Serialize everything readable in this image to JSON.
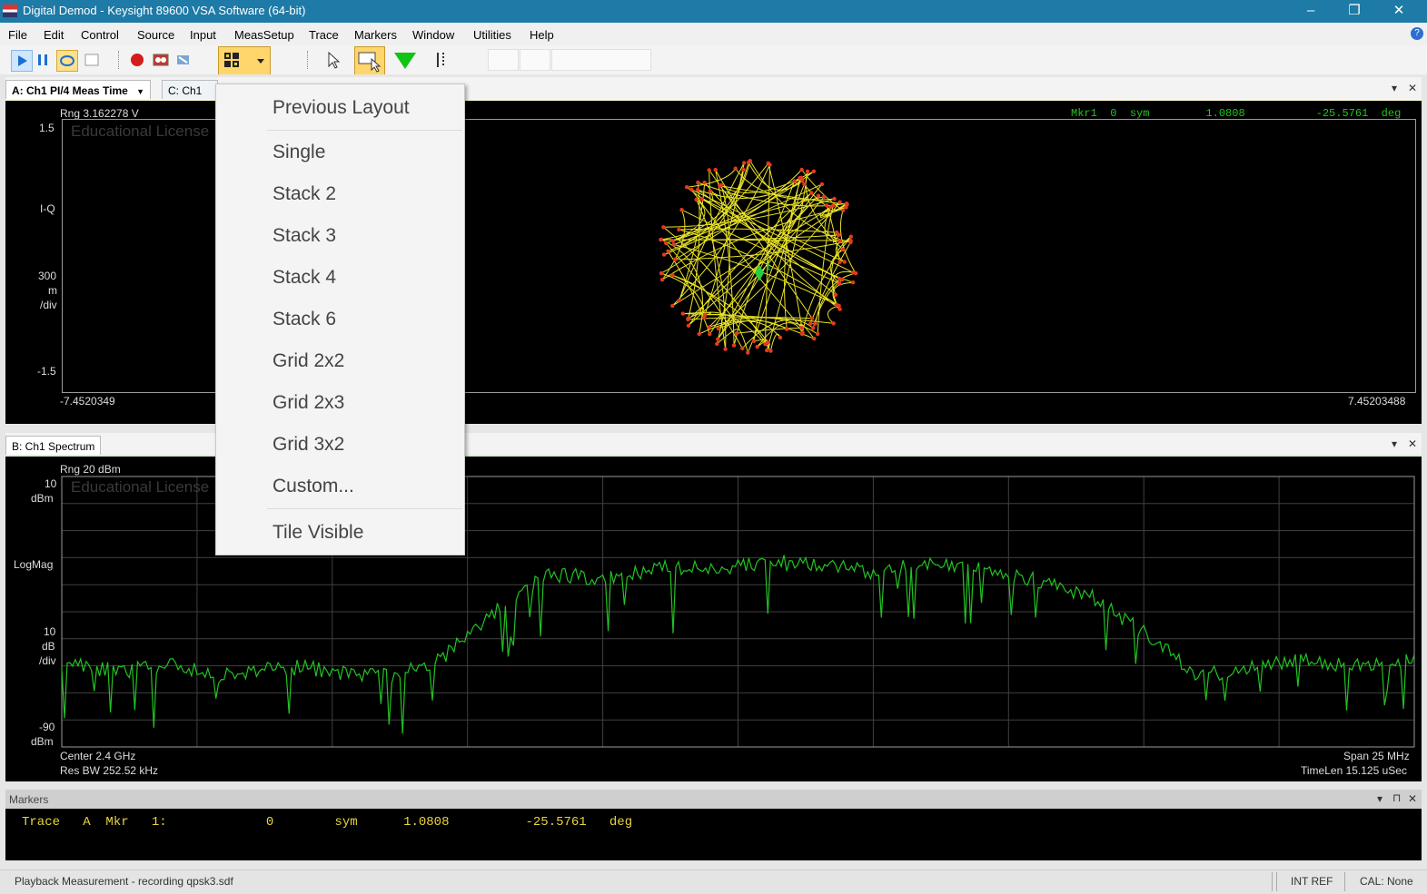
{
  "window": {
    "title": "Digital Demod - Keysight 89600 VSA Software (64-bit)",
    "controls": [
      "–",
      "❐",
      "✕"
    ]
  },
  "menu": [
    "File",
    "Edit",
    "Control",
    "Source",
    "Input",
    "MeasSetup",
    "Trace",
    "Markers",
    "Window",
    "Utilities",
    "Help"
  ],
  "help_badge": "?",
  "toolbar": {
    "icons": [
      "play-icon",
      "pause-icon",
      "restart-icon",
      "single-icon",
      "record-icon",
      "playback-icon",
      "calibrate-icon",
      "layout-icon",
      "pointer-icon",
      "zoom-window-icon",
      "marker-icon",
      "marker-bar-icon"
    ]
  },
  "traceA": {
    "tab": "A: Ch1 PI/4 Meas Time",
    "tab_arrow": "▼",
    "tab_c": "C: Ch1 P",
    "range": "Rng 3.162278  V",
    "y_top": "1.5",
    "y_bottom": "-1.5",
    "format": "I-Q",
    "scale": [
      "300",
      "m",
      "/div"
    ],
    "x_left": "-7.4520349",
    "x_right": "7.45203488",
    "watermark": "Educational License",
    "marker_readout": [
      "Mkr1",
      "0",
      "sym",
      "1.0808",
      "-25.5761",
      "deg"
    ],
    "marker_label": "1",
    "colors": {
      "trace": "#e8e227",
      "symbols": "#e23b1f",
      "marker": "#22d044"
    }
  },
  "traceB": {
    "tab": "B: Ch1 Spectrum",
    "range": "Rng 20 dBm",
    "top_value": "10",
    "top_unit": "dBm",
    "format": "LogMag",
    "scale": [
      "10",
      "dB",
      "/div"
    ],
    "bottom_value": "-90",
    "bottom_unit": "dBm",
    "center": "Center 2.4 GHz",
    "res_bw": "Res BW 252.52 kHz",
    "span": "Span 25 MHz",
    "timelen": "TimeLen 15.125 uSec",
    "watermark": "Educational License",
    "color": "#22c322"
  },
  "panel_controls": {
    "dropdown": "▾",
    "close": "✕",
    "pin": "⊓"
  },
  "layout_menu": {
    "items": [
      "Previous Layout",
      "Single",
      "Stack 2",
      "Stack 3",
      "Stack 4",
      "Stack 6",
      "Grid 2x2",
      "Grid 2x3",
      "Grid 3x2",
      "Custom...",
      "Tile Visible"
    ]
  },
  "markers_panel": {
    "title": "Markers",
    "row": "Trace   A  Mkr   1:             0        sym      1.0808          -25.5761   deg"
  },
  "status": {
    "message": "Playback Measurement - recording qpsk3.sdf",
    "ref": "INT REF",
    "cal": "CAL: None"
  },
  "chart_data": [
    {
      "type": "scatter",
      "title": "A: Ch1 PI/4 Meas Time",
      "subtitle": "I-Q",
      "xlim": [
        -7.4520349,
        7.45203488
      ],
      "ylim": [
        -1.5,
        1.5
      ],
      "marker": {
        "label": "Mkr1",
        "x_sym": 0,
        "magnitude": 1.0808,
        "phase_deg": -25.5761
      }
    },
    {
      "type": "line",
      "title": "B: Ch1 Spectrum",
      "subtitle": "LogMag",
      "xlabel": "",
      "ylabel": "",
      "xlim_mhz": [
        2387.5,
        2412.5
      ],
      "ylim": [
        -90,
        10
      ],
      "x_mhz": [
        2387.5,
        2388.5,
        2389.5,
        2390.5,
        2391.5,
        2392.5,
        2393.5,
        2394.5,
        2395.5,
        2396.5,
        2397.5,
        2398.5,
        2399.5,
        2400.5,
        2401.5,
        2402.5,
        2403.5,
        2404.5,
        2405.5,
        2406.5,
        2407.5,
        2408.5,
        2409.5,
        2410.5,
        2411.5,
        2412.5
      ],
      "y_dbm": [
        -58,
        -62,
        -60,
        -64,
        -60,
        -62,
        -64,
        -58,
        -40,
        -26,
        -28,
        -24,
        -24,
        -22,
        -22,
        -26,
        -22,
        -24,
        -28,
        -34,
        -48,
        -64,
        -60,
        -58,
        -60,
        -58
      ]
    }
  ]
}
